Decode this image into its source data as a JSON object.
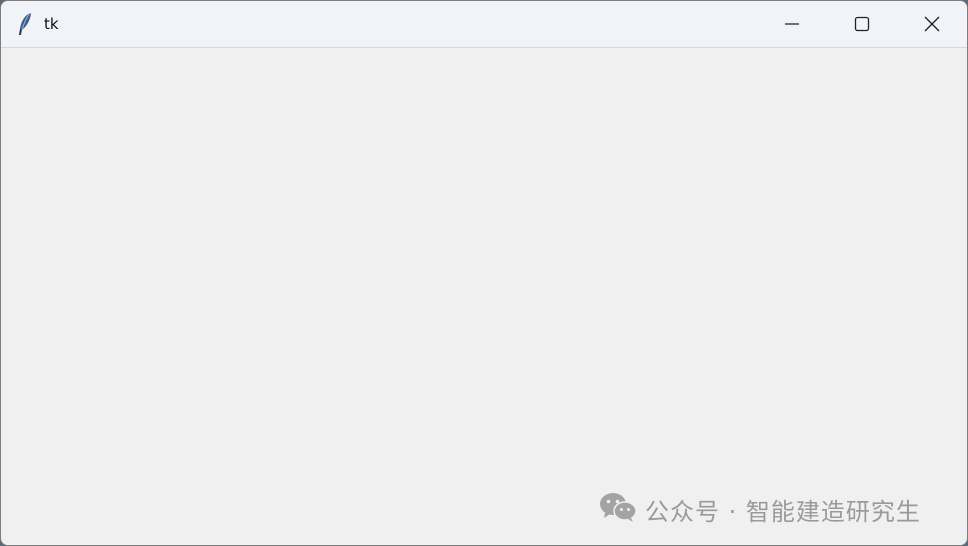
{
  "window": {
    "title": "tk",
    "app_icon": "tk-feather-icon"
  },
  "caption_buttons": {
    "minimize": "minimize-icon",
    "maximize": "maximize-icon",
    "close": "close-icon"
  },
  "watermark": {
    "icon": "wechat-icon",
    "text": "公众号 · 智能建造研究生"
  }
}
